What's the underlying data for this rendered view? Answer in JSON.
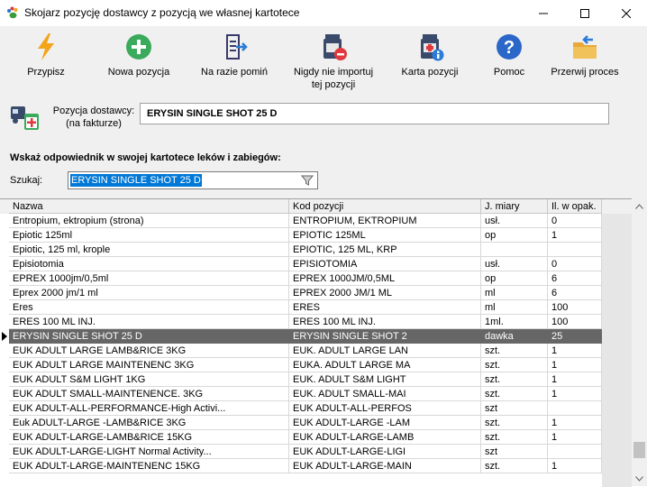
{
  "window": {
    "title": "Skojarz pozycję dostawcy z pozycją we własnej kartotece",
    "minimize_icon": "minimize-icon",
    "maximize_icon": "maximize-icon",
    "close_icon": "close-icon"
  },
  "toolbar": {
    "assign": "Przypisz",
    "new_item": "Nowa pozycja",
    "skip": "Na razie pomiń",
    "never_import_1": "Nigdy nie importuj",
    "never_import_2": "tej pozycji",
    "item_card": "Karta pozycji",
    "help": "Pomoc",
    "abort": "Przerwij proces"
  },
  "supplier": {
    "label_1": "Pozycja dostawcy:",
    "label_2": "(na fakturze)",
    "value": "ERYSIN SINGLE SHOT 25 D"
  },
  "search": {
    "heading": "Wskaż odpowiednik w swojej kartotece leków i zabiegów:",
    "label": "Szukaj:",
    "value": "ERYSIN SINGLE SHOT 25 D"
  },
  "grid": {
    "columns": [
      "Nazwa",
      "Kod pozycji",
      "J. miary",
      "Il. w opak."
    ],
    "selected_index": 8,
    "rows": [
      [
        "Entropium, ektropium (strona)",
        "ENTROPIUM, EKTROPIUM",
        "usł.",
        "0"
      ],
      [
        "Epiotic 125ml",
        "EPIOTIC 125ML",
        "op",
        "1"
      ],
      [
        "Epiotic, 125 ml, krople",
        "EPIOTIC, 125 ML, KRP",
        "",
        ""
      ],
      [
        "Episiotomia",
        "EPISIOTOMIA",
        "usł.",
        "0"
      ],
      [
        "EPREX 1000jm/0,5ml",
        "EPREX 1000JM/0,5ML",
        "op",
        "6"
      ],
      [
        "Eprex 2000 jm/1 ml",
        "EPREX 2000 JM/1 ML",
        "ml",
        "6"
      ],
      [
        "Eres",
        "ERES",
        "ml",
        "100"
      ],
      [
        "ERES 100 ML INJ.",
        "ERES 100 ML INJ.",
        "1ml.",
        "100"
      ],
      [
        "ERYSIN SINGLE SHOT 25 D",
        "ERYSIN SINGLE SHOT 2",
        "dawka",
        "25"
      ],
      [
        "EUK ADULT LARGE LAMB&RICE 3KG",
        "EUK. ADULT LARGE LAN",
        "szt.",
        "1"
      ],
      [
        "EUK ADULT LARGE MAINTENENC 3KG",
        "EUKA. ADULT LARGE MA",
        "szt.",
        "1"
      ],
      [
        "EUK ADULT S&M LIGHT 1KG",
        "EUK. ADULT S&M LIGHT",
        "szt.",
        "1"
      ],
      [
        "EUK ADULT SMALL-MAINTENENCE. 3KG",
        "EUK. ADULT SMALL-MAI",
        "szt.",
        "1"
      ],
      [
        "EUK ADULT-ALL-PERFORMANCE-High Activi...",
        "EUK ADULT-ALL-PERFOS",
        "szt",
        ""
      ],
      [
        "Euk ADULT-LARGE -LAMB&RICE 3KG",
        "EUK ADULT-LARGE -LAM",
        "szt.",
        "1"
      ],
      [
        "EUK ADULT-LARGE-LAMB&RICE 15KG",
        "EUK ADULT-LARGE-LAMB",
        "szt.",
        "1"
      ],
      [
        "EUK ADULT-LARGE-LIGHT Normal Activity...",
        "EUK ADULT-LARGE-LIGI",
        "szt",
        ""
      ],
      [
        "EUK ADULT-LARGE-MAINTENENC 15KG",
        "EUK ADULT-LARGE-MAIN",
        "szt.",
        "1"
      ]
    ]
  }
}
